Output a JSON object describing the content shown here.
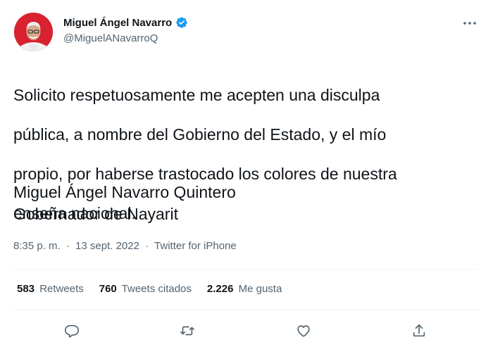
{
  "author": {
    "name": "Miguel Ángel Navarro",
    "handle": "@MiguelANavarroQ"
  },
  "tweet": {
    "lines": [
      "Solicito respetuosamente me acepten una disculpa",
      "pública, a nombre del Gobierno del Estado, y el mío",
      "propio, por haberse trastocado los colores de nuestra",
      "enseña nacional."
    ],
    "signature_name": "Miguel Ángel Navarro Quintero",
    "signature_title": "Gobernador de Nayarit"
  },
  "meta": {
    "time": "8:35 p. m.",
    "date": "13 sept. 2022",
    "source": "Twitter for iPhone",
    "separator": "·"
  },
  "stats": {
    "retweets_count": "583",
    "retweets_label": "Retweets",
    "quotes_count": "760",
    "quotes_label": "Tweets citados",
    "likes_count": "2.226",
    "likes_label": "Me gusta"
  },
  "colors": {
    "verified": "#1d9bf0",
    "secondary_text": "#536471",
    "avatar_bg": "#d8222f"
  },
  "icons": {
    "more": "more-horizontal-icon",
    "reply": "reply-icon",
    "retweet": "retweet-icon",
    "like": "heart-icon",
    "share": "share-icon",
    "verified": "verified-badge-icon"
  }
}
